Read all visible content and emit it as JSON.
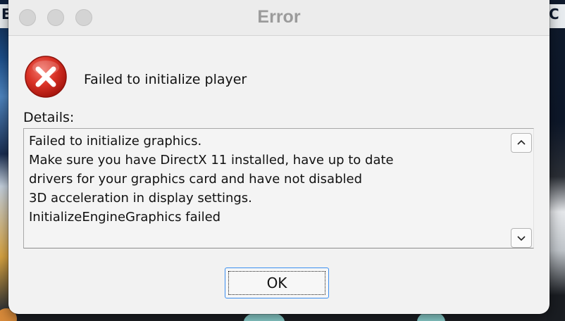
{
  "window": {
    "title": "Error"
  },
  "message": {
    "headline": "Failed to initialize player",
    "icon": "error-x-icon",
    "icon_color": "#d93226"
  },
  "details": {
    "label": "Details:",
    "text": "Failed to initialize graphics.\nMake sure you have DirectX 11 installed, have up to date\ndrivers for your graphics card and have not disabled\n3D acceleration in display settings.\nInitializeEngineGraphics failed"
  },
  "buttons": {
    "ok_label": "OK"
  },
  "colors": {
    "dialog_bg": "#f2f2f2",
    "focus_border": "#3b8ef0"
  }
}
